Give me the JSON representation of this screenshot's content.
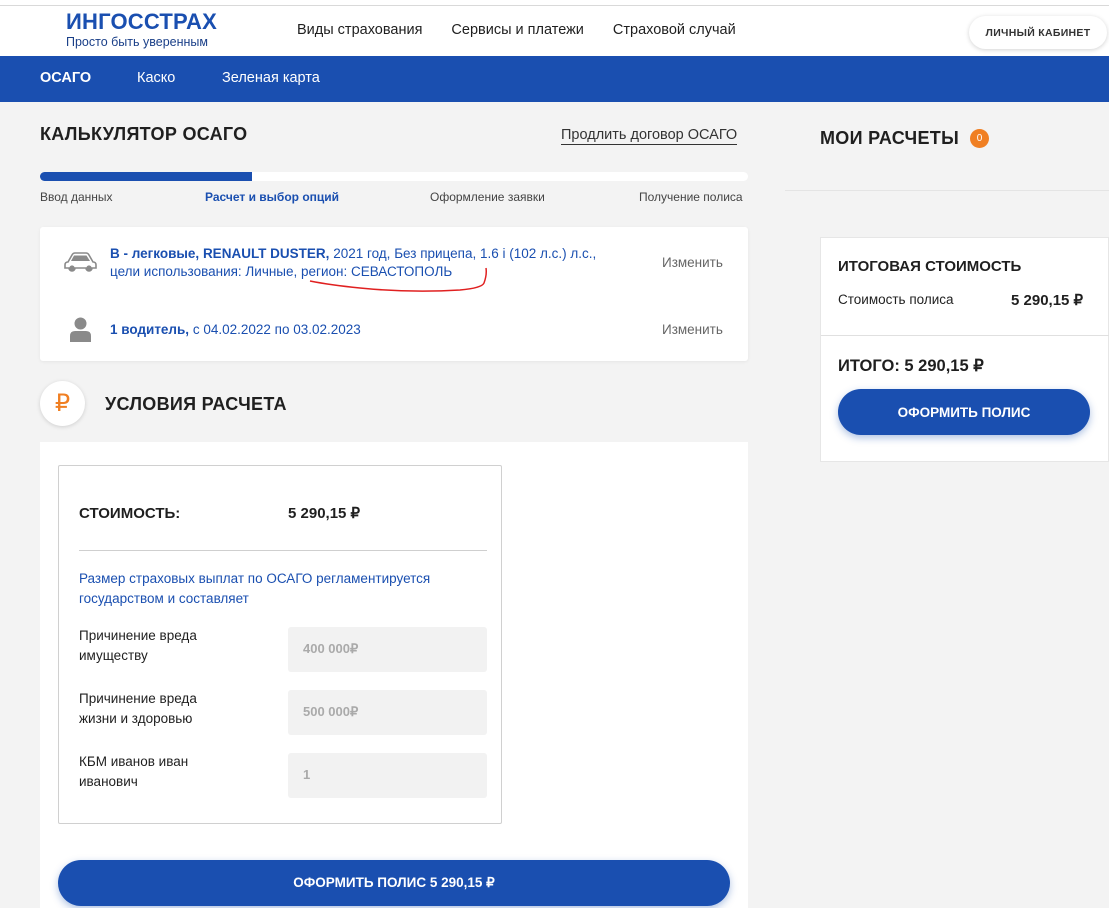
{
  "colors": {
    "brand_blue": "#1a4fb0",
    "accent_orange": "#f07f22",
    "annotation_red": "#e02020"
  },
  "header": {
    "logo_name": "ИНГОССТРАХ",
    "logo_tagline": "Просто быть уверенным",
    "nav": [
      "Виды страхования",
      "Сервисы и платежи",
      "Страховой случай"
    ],
    "cabinet_label": "ЛИЧНЫЙ КАБИНЕТ"
  },
  "subnav": {
    "items": [
      "ОСАГО",
      "Каско",
      "Зеленая карта"
    ],
    "active": "ОСАГО"
  },
  "calculator": {
    "title": "КАЛЬКУЛЯТОР ОСАГО",
    "renew_link": "Продлить договор ОСАГО",
    "progress_fraction": 0.3,
    "steps": [
      "Ввод данных",
      "Расчет и выбор опций",
      "Оформление заявки",
      "Получение полиса"
    ],
    "active_step": "Расчет и выбор опций"
  },
  "summary": {
    "vehicle_bold": "В - легковые, RENAULT DUSTER,",
    "vehicle_line1": " 2021 год, Без прицепа, 1.6 i (102 л.с.) л.с.,",
    "vehicle_line2": "цели использования: Личные, регион: СЕВАСТОПОЛЬ",
    "vehicle_icon": "car-icon",
    "driver_bold": "1 водитель,",
    "driver_rest": " с 04.02.2022 по 03.02.2023",
    "driver_icon": "person-icon",
    "change_label": "Изменить"
  },
  "conditions": {
    "icon_glyph": "₽",
    "title": "УСЛОВИЯ РАСЧЕТА",
    "cost_label": "СТОИМОСТЬ:",
    "cost_value": "5 290,15 ₽",
    "note": "Размер страховых выплат по ОСАГО регламентируется государством и составляет",
    "fields": [
      {
        "label": "Причинение вреда имуществу",
        "value": "400 000₽"
      },
      {
        "label": "Причинение вреда жизни и здоровью",
        "value": "500 000₽"
      },
      {
        "label": "КБМ иванов иван иванович",
        "value": "1"
      }
    ],
    "submit_label": "ОФОРМИТЬ ПОЛИС 5 290,15 ₽"
  },
  "sidebar": {
    "title": "МОИ РАСЧЕТЫ",
    "badge_count": "0",
    "total_title": "ИТОГОВАЯ СТОИМОСТЬ",
    "policy_cost_label": "Стоимость полиса",
    "policy_cost_value": "5 290,15 ₽",
    "total_line": "ИТОГО: 5 290,15 ₽",
    "button_label": "ОФОРМИТЬ ПОЛИС"
  }
}
